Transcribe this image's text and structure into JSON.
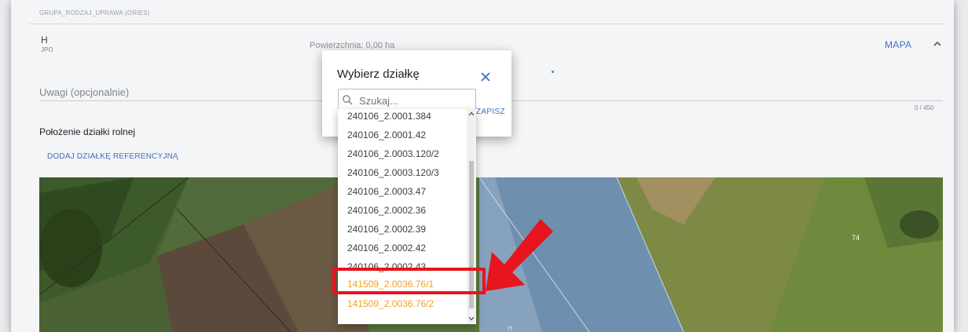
{
  "form": {
    "top_strip": "GRUPA_RODZAJ_UPRAWA (ORIES)",
    "item_letter": "H",
    "item_sub": "JPO",
    "area_text": "Powierzchnia: 0,00 ha",
    "map_button": "MAPA",
    "notes_placeholder": "Uwagi (opcjonalnie)",
    "notes_counter": "0 / 450",
    "section_title": "Położenie działki rolnej",
    "add_reference_button": "DODAJ DZIAŁKĘ REFERENCYJNĄ"
  },
  "map": {
    "label_74": "74",
    "label_h": "H"
  },
  "modal": {
    "title": "Wybierz działkę",
    "save_button": "ZAPISZ",
    "search_placeholder": "Szukaj...",
    "items": [
      {
        "label": "240106_2.0001.384",
        "highlight": false
      },
      {
        "label": "240106_2.0001.42",
        "highlight": false
      },
      {
        "label": "240106_2.0003.120/2",
        "highlight": false
      },
      {
        "label": "240106_2.0003.120/3",
        "highlight": false
      },
      {
        "label": "240106_2.0003.47",
        "highlight": false
      },
      {
        "label": "240106_2.0002.36",
        "highlight": false
      },
      {
        "label": "240106_2.0002.39",
        "highlight": false
      },
      {
        "label": "240106_2.0002.42",
        "highlight": false
      },
      {
        "label": "240106_2.0002.43",
        "highlight": false
      },
      {
        "label": "141509_2.0036.76/1",
        "highlight": true
      },
      {
        "label": "141509_2.0036.76/2",
        "highlight": true
      }
    ]
  },
  "colors": {
    "accent": "#3f6fc0",
    "highlight_item": "#f0a020",
    "annotation_red": "#e8141e"
  }
}
